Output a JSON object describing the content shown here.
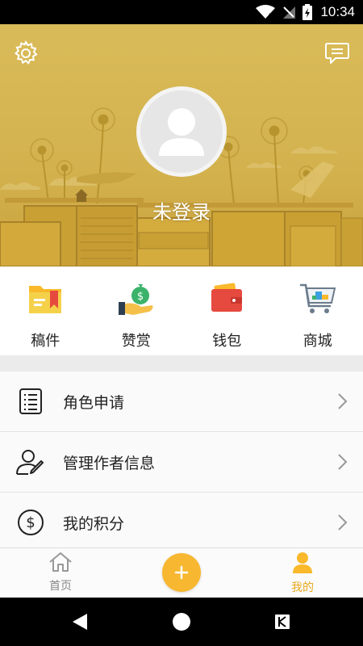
{
  "status_bar": {
    "time": "10:34"
  },
  "header": {
    "login_status": "未登录"
  },
  "quick_menu": [
    {
      "label": "稿件",
      "icon": "folder-bookmark-icon"
    },
    {
      "label": "赞赏",
      "icon": "money-bag-hand-icon"
    },
    {
      "label": "钱包",
      "icon": "wallet-icon"
    },
    {
      "label": "商城",
      "icon": "shopping-cart-icon"
    }
  ],
  "menu_list": [
    {
      "label": "角色申请",
      "icon": "document-list-icon"
    },
    {
      "label": "管理作者信息",
      "icon": "user-edit-icon"
    },
    {
      "label": "我的积分",
      "icon": "dollar-circle-icon"
    }
  ],
  "bottom_nav": {
    "home_label": "首页",
    "mine_label": "我的",
    "active_tab": "我的"
  },
  "colors": {
    "accent": "#f7b731",
    "header_bg": "#d9bb59",
    "active_tab": "#e9a81e"
  }
}
